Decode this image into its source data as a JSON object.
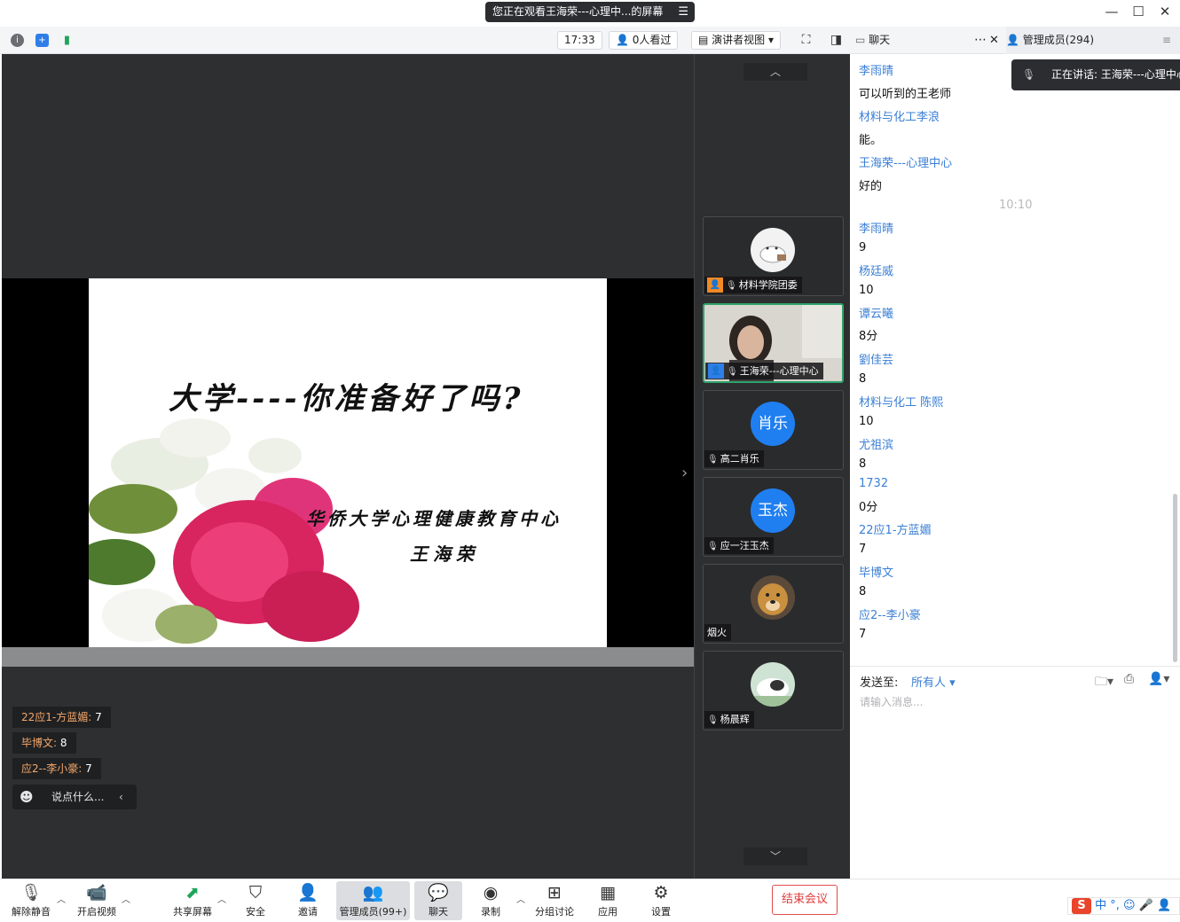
{
  "window": {
    "banner": "您正在观看王海荣---心理中...的屏幕",
    "minimize": "—",
    "maximize": "☐",
    "close": "✕"
  },
  "topbar": {
    "info_icon": "info-icon",
    "security_icon": "shield-icon",
    "signal_icon": "signal-icon",
    "timer": "17:33",
    "viewers": "0人看过",
    "view_mode": "演讲者视图"
  },
  "stage": {
    "slide_title": "大学----你准备好了吗?",
    "slide_org": "华侨大学心理健康教育中心",
    "slide_author": "王海荣",
    "danmu": [
      {
        "who": "22应1-方蓝媚:",
        "text": " 7"
      },
      {
        "who": "毕博文:",
        "text": " 8"
      },
      {
        "who": "应2--李小豪:",
        "text": " 7"
      }
    ],
    "say_placeholder": "说点什么..."
  },
  "participants": [
    {
      "name": "材料学院团委",
      "avatar_text": "",
      "avatar_color": "#f2f2f2",
      "host": true
    },
    {
      "name": "王海荣---心理中心",
      "avatar_text": "",
      "avatar_color": "#8a7d72",
      "host": true,
      "active": true
    },
    {
      "name": "高二肖乐",
      "avatar_text": "肖乐",
      "avatar_color": "#1f7ff0"
    },
    {
      "name": "应一汪玉杰",
      "avatar_text": "玉杰",
      "avatar_color": "#1f7ff0"
    },
    {
      "name": "烟火",
      "avatar_text": "",
      "avatar_color": "#c08a3e"
    },
    {
      "name": "杨晨辉",
      "avatar_text": "",
      "avatar_color": "#cfe3d4"
    }
  ],
  "chat": {
    "tab_chat": "聊天",
    "tab_members": "管理成员(294)",
    "speaking": "正在讲话: 王海荣---心理中心",
    "messages": [
      {
        "sender": "李雨晴",
        "text": "可以听到的王老师"
      },
      {
        "sender": "材料与化工李浪",
        "text": "能。"
      },
      {
        "sender": "王海荣---心理中心",
        "text": "好的"
      },
      {
        "time": "10:10"
      },
      {
        "sender": "李雨晴",
        "text": "9"
      },
      {
        "sender": "杨廷威",
        "text": "10"
      },
      {
        "sender": "谭云曦",
        "text": "8分"
      },
      {
        "sender": "劉佳芸",
        "text": "8"
      },
      {
        "sender": "材料与化工 陈熙",
        "text": "10"
      },
      {
        "sender": "尤祖滨",
        "text": "8"
      },
      {
        "sender": "1732",
        "text": "0分"
      },
      {
        "sender": "22应1-方蓝媚",
        "text": "7"
      },
      {
        "sender": "毕博文",
        "text": "8"
      },
      {
        "sender": "应2--李小豪",
        "text": "7"
      }
    ],
    "send_to_label": "发送至:",
    "send_to_target": "所有人",
    "input_placeholder": "请输入消息..."
  },
  "bottombar": {
    "unmute": "解除静音",
    "start_video": "开启视频",
    "share_screen": "共享屏幕",
    "security": "安全",
    "invite": "邀请",
    "members": "管理成员(99+)",
    "chat": "聊天",
    "record": "录制",
    "breakout": "分组讨论",
    "apps": "应用",
    "settings": "设置",
    "end_meeting": "结束会议"
  },
  "ime": {
    "logo": "S",
    "text": "中 °, ☺ 🎤 👤"
  }
}
